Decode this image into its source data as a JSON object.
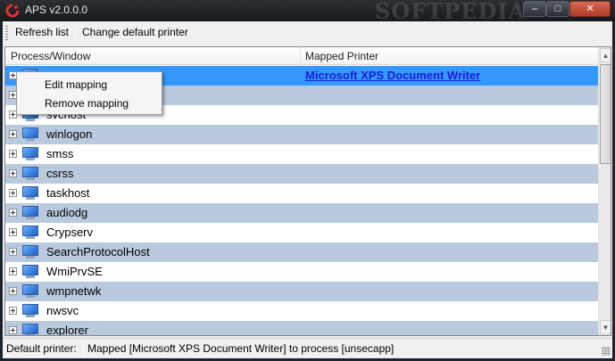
{
  "window": {
    "title": "APS  v2.0.0.0",
    "watermark": "SOFTPEDIA",
    "buttons": {
      "minimize": "–",
      "maximize": "□",
      "close": "✕"
    }
  },
  "toolbar": {
    "refresh_label": "Refresh list",
    "change_default_label": "Change default printer"
  },
  "list": {
    "columns": [
      "Process/Window",
      "Mapped Printer"
    ],
    "rows": [
      {
        "name": "",
        "printer": "Microsoft XPS Document Writer",
        "selected": true
      },
      {
        "name": "",
        "printer": ""
      },
      {
        "name": "svchost",
        "printer": ""
      },
      {
        "name": "winlogon",
        "printer": ""
      },
      {
        "name": "smss",
        "printer": ""
      },
      {
        "name": "csrss",
        "printer": ""
      },
      {
        "name": "taskhost",
        "printer": ""
      },
      {
        "name": "audiodg",
        "printer": ""
      },
      {
        "name": "Crypserv",
        "printer": ""
      },
      {
        "name": "SearchProtocolHost",
        "printer": ""
      },
      {
        "name": "WmiPrvSE",
        "printer": ""
      },
      {
        "name": "wmpnetwk",
        "printer": ""
      },
      {
        "name": "nwsvc",
        "printer": ""
      },
      {
        "name": "explorer",
        "printer": ""
      }
    ]
  },
  "context_menu": {
    "edit": "Edit mapping",
    "remove": "Remove mapping"
  },
  "status": {
    "label": "Default printer:",
    "message": "Mapped [Microsoft XPS Document Writer] to process [unsecapp]"
  },
  "colors": {
    "row_alt": "#b9c9de",
    "selected": "#3399ff",
    "link": "#1b1bd8"
  }
}
